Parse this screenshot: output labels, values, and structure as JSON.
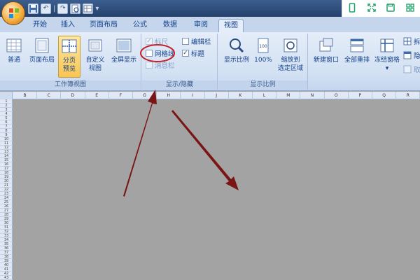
{
  "qat": {
    "undo_label": "↶",
    "redo_label": "↷",
    "separator": "|",
    "more_label": "▾"
  },
  "tabs": [
    {
      "label": "开始"
    },
    {
      "label": "插入"
    },
    {
      "label": "页面布局"
    },
    {
      "label": "公式"
    },
    {
      "label": "数据"
    },
    {
      "label": "审阅"
    },
    {
      "label": "视图",
      "active": true
    }
  ],
  "ribbon": {
    "workbook_views": {
      "group_label": "工作簿视图",
      "buttons": [
        {
          "line1": "普通",
          "line2": ""
        },
        {
          "line1": "页面布局",
          "line2": ""
        },
        {
          "line1": "分页",
          "line2": "预览",
          "pressed": true
        },
        {
          "line1": "自定义",
          "line2": "视图"
        },
        {
          "line1": "全屏显示",
          "line2": ""
        }
      ]
    },
    "show_hide": {
      "group_label": "显示/隐藏",
      "checkboxes": [
        {
          "label": "标尺",
          "checked": true,
          "enabled": false
        },
        {
          "label": "网格线",
          "checked": false,
          "enabled": true
        },
        {
          "label": "消息栏",
          "checked": false,
          "enabled": false
        },
        {
          "label": "编辑栏",
          "checked": false,
          "enabled": true
        },
        {
          "label": "标题",
          "checked": true,
          "enabled": true
        }
      ]
    },
    "zoom": {
      "group_label": "显示比例",
      "buttons": [
        {
          "line1": "显示比例",
          "line2": ""
        },
        {
          "line1": "100%",
          "line2": ""
        },
        {
          "line1": "缩放到",
          "line2": "选定区域"
        }
      ]
    },
    "window": {
      "buttons": [
        {
          "line1": "新建窗口",
          "line2": ""
        },
        {
          "line1": "全部重排",
          "line2": ""
        },
        {
          "line1": "冻结窗格",
          "line2": "▾"
        }
      ],
      "small_buttons": [
        {
          "label": "拆"
        },
        {
          "label": "隐"
        },
        {
          "label": "取"
        }
      ]
    }
  },
  "sheet": {
    "columns": [
      "B",
      "C",
      "D",
      "E",
      "F",
      "G",
      "H",
      "I",
      "J",
      "K",
      "L",
      "M",
      "N",
      "O",
      "P",
      "Q",
      "R"
    ],
    "rows": [
      "1",
      "2",
      "3",
      "4",
      "5",
      "6",
      "7",
      "8",
      "9",
      "10",
      "11",
      "12",
      "13",
      "14",
      "15",
      "16",
      "17",
      "18",
      "19",
      "20",
      "21",
      "22",
      "23",
      "24",
      "25",
      "26",
      "27",
      "28",
      "29",
      "30",
      "31",
      "32",
      "33",
      "34",
      "35",
      "36",
      "37",
      "38",
      "39",
      "40",
      "41",
      "42",
      "43"
    ]
  },
  "annotation": {
    "circle_color": "#c4202a",
    "arrow_color": "#7a1515"
  },
  "icons": [
    "office-logo-icon",
    "save-icon",
    "undo-icon",
    "redo-icon",
    "print-preview-icon",
    "table-icon",
    "phone-icon",
    "expand-icon",
    "save-disk-icon",
    "grid-icon",
    "zoom-icon",
    "new-window-icon"
  ]
}
